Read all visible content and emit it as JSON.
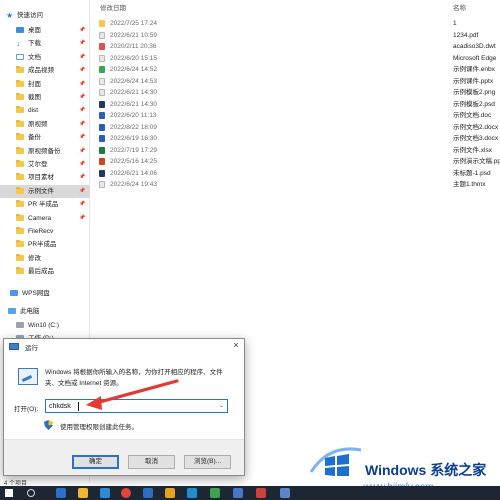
{
  "explorer": {
    "nav": {
      "quick_access": "快速访问",
      "items": [
        {
          "label": "桌面",
          "icon": "desktop-icon",
          "pinned": true
        },
        {
          "label": "下载",
          "icon": "download-icon",
          "pinned": true
        },
        {
          "label": "文档",
          "icon": "document-icon",
          "pinned": true
        },
        {
          "label": "成品视频",
          "icon": "folder-icon",
          "pinned": true
        },
        {
          "label": "封面",
          "icon": "folder-icon",
          "pinned": true
        },
        {
          "label": "截图",
          "icon": "folder-icon",
          "pinned": true
        },
        {
          "label": "dist",
          "icon": "folder-icon",
          "pinned": true
        },
        {
          "label": "原视频",
          "icon": "folder-icon",
          "pinned": true
        },
        {
          "label": "备份",
          "icon": "folder-icon",
          "pinned": true
        },
        {
          "label": "原视频备份",
          "icon": "folder-icon",
          "pinned": true
        },
        {
          "label": "艾尔登",
          "icon": "folder-icon",
          "pinned": true
        },
        {
          "label": "项目素材",
          "icon": "folder-icon",
          "pinned": true
        },
        {
          "label": "示例文件",
          "icon": "folder-icon",
          "pinned": true,
          "selected": true
        },
        {
          "label": "PR 半成品",
          "icon": "folder-icon",
          "pinned": true
        },
        {
          "label": "Camera",
          "icon": "folder-icon",
          "pinned": true
        },
        {
          "label": "FileRecv",
          "icon": "folder-icon",
          "pinned": false
        },
        {
          "label": "PR半成品",
          "icon": "folder-icon",
          "pinned": false
        },
        {
          "label": "修改",
          "icon": "folder-icon",
          "pinned": false
        },
        {
          "label": "最后成品",
          "icon": "folder-icon",
          "pinned": false
        }
      ],
      "wps": "WPS网盘",
      "this_pc": "此电脑",
      "drive": "Win10 (C:)",
      "partial": "工作 (D:)",
      "bottom": "4 个项目"
    },
    "columns": {
      "date": "修改日期",
      "name": "名称"
    },
    "files": [
      {
        "date": "2022/7/25 17:24",
        "name": "1",
        "icon": "folder"
      },
      {
        "date": "2022/6/21 10:59",
        "name": "1234.pdf",
        "icon": "file"
      },
      {
        "date": "2020/2/11 20:36",
        "name": "acadiso3D.dwt",
        "icon": "dwt"
      },
      {
        "date": "2022/6/20 15:15",
        "name": "Microsoft Edge",
        "icon": "file"
      },
      {
        "date": "2022/6/24 14:52",
        "name": "示例课件.enbx",
        "icon": "enbx"
      },
      {
        "date": "2022/6/24 14:53",
        "name": "示例课件.pptx",
        "icon": "file"
      },
      {
        "date": "2022/6/21 14:30",
        "name": "示例模板2.png",
        "icon": "file"
      },
      {
        "date": "2022/6/21 14:30",
        "name": "示例模板2.psd",
        "icon": "psd"
      },
      {
        "date": "2022/6/20 11:13",
        "name": "示例文档.doc",
        "icon": "doc"
      },
      {
        "date": "2022/8/22 18:09",
        "name": "示例文档2.docx",
        "icon": "doc"
      },
      {
        "date": "2022/6/19 16:30",
        "name": "示例文档3.docx",
        "icon": "doc"
      },
      {
        "date": "2022/7/19 17:29",
        "name": "示例文件.xlsx",
        "icon": "xlsx"
      },
      {
        "date": "2022/5/16 14:25",
        "name": "示例演示文稿.pptx",
        "icon": "pptx"
      },
      {
        "date": "2022/6/21 14:06",
        "name": "未标题-1.psd",
        "icon": "psd"
      },
      {
        "date": "2022/6/24 19:43",
        "name": "主题1.thmx",
        "icon": "file"
      }
    ]
  },
  "run_dialog": {
    "title": "运行",
    "description": "Windows 将根据你所输入的名称，为你打开相应的程序、文件夹、文档或 Internet 资源。",
    "open_label": "打开(O):",
    "input_value": "chkdsk",
    "admin_note": "使用管理权限创建此任务。",
    "ok": "确定",
    "cancel": "取消",
    "browse": "浏览(B)...",
    "close_glyph": "×"
  },
  "watermark": {
    "brand": "Windows 系统之家",
    "site": "www.bjjmlv.com"
  },
  "colors": {
    "accent": "#2b72c6",
    "arrow": "#e53935",
    "selection": "#d9d9d9",
    "taskbar": "#1c2733"
  }
}
